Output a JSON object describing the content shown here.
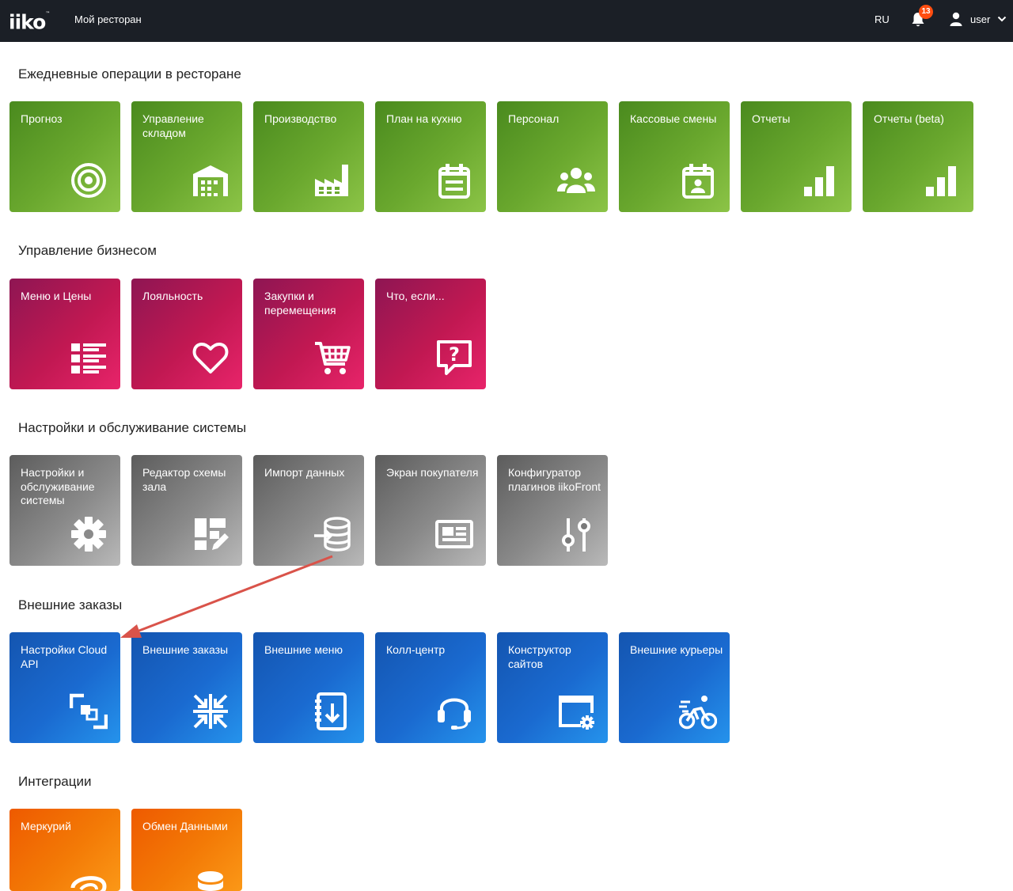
{
  "header": {
    "logo": "iiko",
    "logo_tm": "™",
    "restaurant": "Мой ресторан",
    "language": "RU",
    "notifications_count": "13",
    "user": "user"
  },
  "sections": [
    {
      "title": "Ежедневные операции в ресторане",
      "color": "#6aa82e",
      "tiles": [
        {
          "label": "Прогноз",
          "icon": "target-icon"
        },
        {
          "label": "Управление складом",
          "icon": "warehouse-icon"
        },
        {
          "label": "Производство",
          "icon": "factory-icon"
        },
        {
          "label": "План на кухню",
          "icon": "calendar-list-icon"
        },
        {
          "label": "Персонал",
          "icon": "people-icon"
        },
        {
          "label": "Кассовые смены",
          "icon": "calendar-person-icon"
        },
        {
          "label": "Отчеты",
          "icon": "bar-chart-icon"
        },
        {
          "label": "Отчеты (beta)",
          "icon": "bar-chart-icon"
        }
      ]
    },
    {
      "title": "Управление бизнесом",
      "color": "#c11852",
      "tiles": [
        {
          "label": "Меню и Цены",
          "icon": "menu-list-icon"
        },
        {
          "label": "Лояльность",
          "icon": "heart-icon"
        },
        {
          "label": "Закупки и перемещения",
          "icon": "cart-icon"
        },
        {
          "label": "Что, если...",
          "icon": "question-bubble-icon"
        }
      ]
    },
    {
      "title": "Настройки и обслуживание системы",
      "color": "#8a8a8a",
      "tiles": [
        {
          "label": "Настройки и обслуживание системы",
          "icon": "gear-icon"
        },
        {
          "label": "Редактор схемы зала",
          "icon": "layout-edit-icon"
        },
        {
          "label": "Импорт данных",
          "icon": "database-import-icon"
        },
        {
          "label": "Экран покупателя",
          "icon": "screen-icon"
        },
        {
          "label": "Конфигуратор плагинов iikoFront",
          "icon": "sliders-icon"
        }
      ]
    },
    {
      "title": "Внешние заказы",
      "color": "#1a6ad0",
      "tiles": [
        {
          "label": "Настройки Cloud API",
          "icon": "cloud-api-icon"
        },
        {
          "label": "Внешние заказы",
          "icon": "collapse-arrows-icon"
        },
        {
          "label": "Внешние меню",
          "icon": "notebook-download-icon"
        },
        {
          "label": "Колл-центр",
          "icon": "headset-icon"
        },
        {
          "label": "Конструктор сайтов",
          "icon": "window-gear-icon"
        },
        {
          "label": "Внешние курьеры",
          "icon": "bicycle-icon"
        }
      ]
    },
    {
      "title": "Интеграции",
      "color": "#f37a06",
      "tiles": [
        {
          "label": "Меркурий",
          "icon": "mercury-icon"
        },
        {
          "label": "Обмен Данными",
          "icon": "database-icon"
        }
      ]
    }
  ]
}
